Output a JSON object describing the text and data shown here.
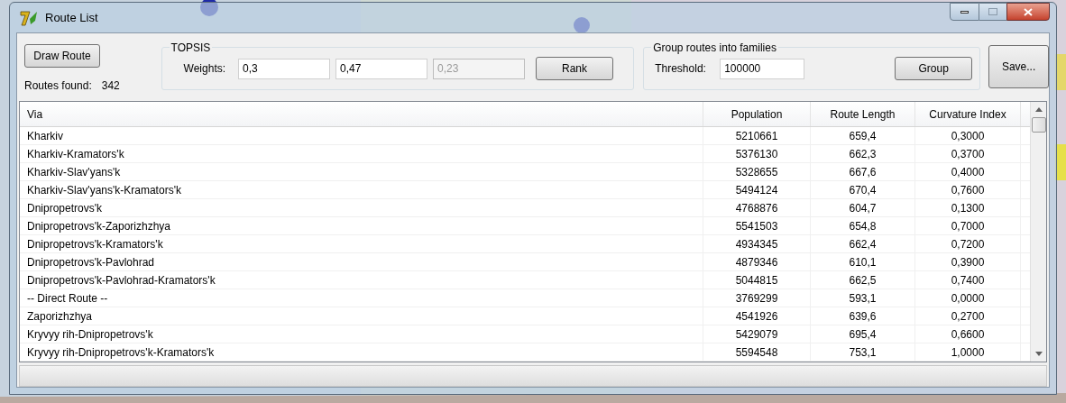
{
  "window": {
    "title": "Route List"
  },
  "draw_route": {
    "label": "Draw Route"
  },
  "routes_found": {
    "label": "Routes found:",
    "value": "342"
  },
  "topsis": {
    "title": "TOPSIS",
    "weights_label": "Weights:",
    "weights": [
      {
        "value": "0,3",
        "disabled": false
      },
      {
        "value": "0,47",
        "disabled": false
      },
      {
        "value": "0,23",
        "disabled": true
      }
    ],
    "rank_button": "Rank"
  },
  "grouping": {
    "title": "Group routes into families",
    "threshold_label": "Threshold:",
    "threshold": "100000",
    "group_button": "Group"
  },
  "save_button": "Save...",
  "table": {
    "columns": [
      "Via",
      "Population",
      "Route Length",
      "Curvature Index"
    ],
    "rows": [
      [
        "Kharkiv",
        "5210661",
        "659,4",
        "0,3000"
      ],
      [
        "Kharkiv-Kramators'k",
        "5376130",
        "662,3",
        "0,3700"
      ],
      [
        "Kharkiv-Slav'yans'k",
        "5328655",
        "667,6",
        "0,4000"
      ],
      [
        "Kharkiv-Slav'yans'k-Kramators'k",
        "5494124",
        "670,4",
        "0,7600"
      ],
      [
        "Dnipropetrovs'k",
        "4768876",
        "604,7",
        "0,1300"
      ],
      [
        "Dnipropetrovs'k-Zaporizhzhya",
        "5541503",
        "654,8",
        "0,7000"
      ],
      [
        "Dnipropetrovs'k-Kramators'k",
        "4934345",
        "662,4",
        "0,7200"
      ],
      [
        "Dnipropetrovs'k-Pavlohrad",
        "4879346",
        "610,1",
        "0,3900"
      ],
      [
        "Dnipropetrovs'k-Pavlohrad-Kramators'k",
        "5044815",
        "662,5",
        "0,7400"
      ],
      [
        "-- Direct Route --",
        "3769299",
        "593,1",
        "0,0000"
      ],
      [
        "Zaporizhzhya",
        "4541926",
        "639,6",
        "0,2700"
      ],
      [
        "Kryvyy rih-Dnipropetrovs'k",
        "5429079",
        "695,4",
        "0,6600"
      ],
      [
        "Kryvyy rih-Dnipropetrovs'k-Kramators'k",
        "5594548",
        "753,1",
        "1,0000"
      ]
    ]
  }
}
